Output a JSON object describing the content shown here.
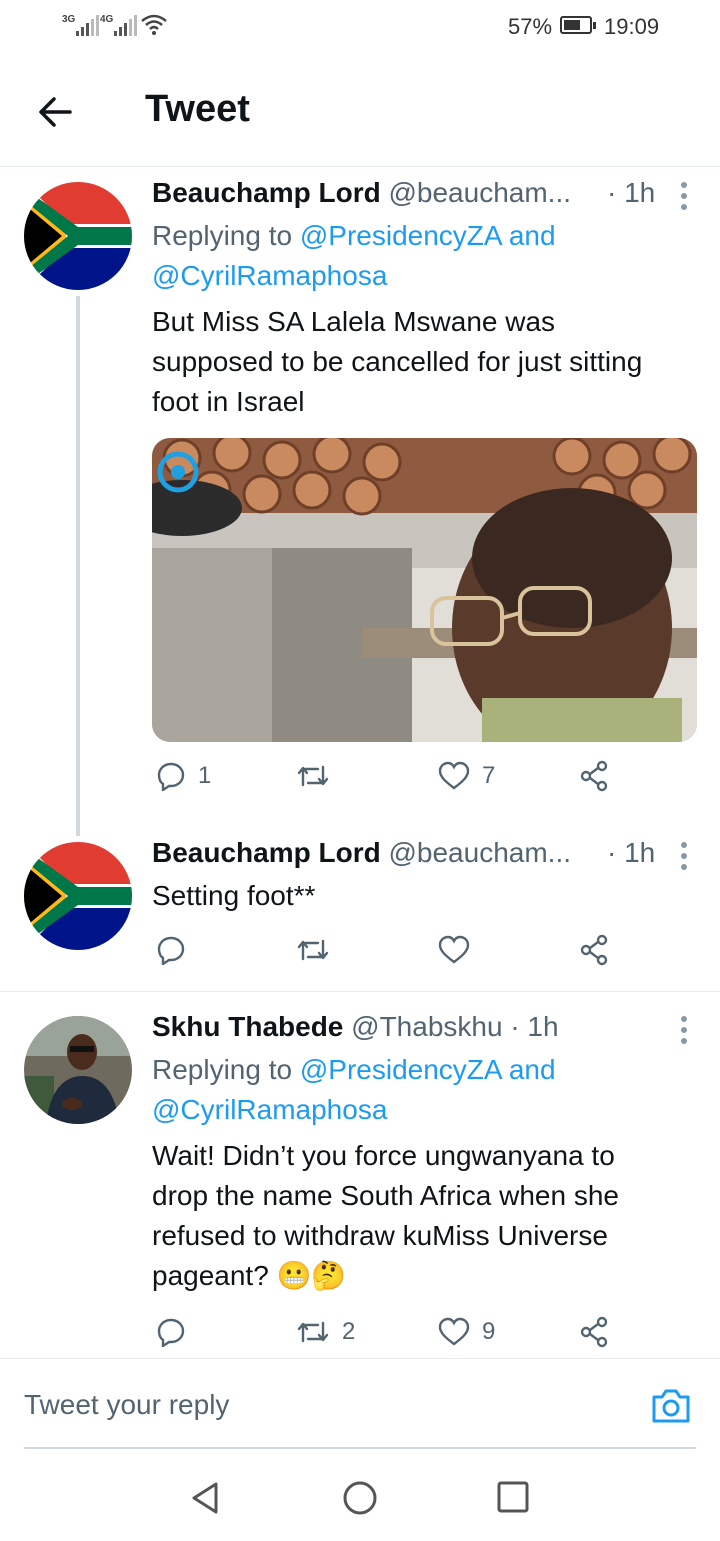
{
  "status": {
    "sim1": "3G",
    "sim2": "4G",
    "battery": "57%",
    "time": "19:09"
  },
  "header": {
    "title": "Tweet",
    "back_icon": "arrow-left-icon"
  },
  "tweets": [
    {
      "name": "Beauchamp Lord",
      "handle": "@beaucham...",
      "time": "· 1h",
      "replying_prefix": "Replying to",
      "replying_to": "@PresidencyZA and",
      "replying_to_2": "@CyrilRamaphosa",
      "text_lines": [
        "But Miss SA Lalela Mswane was",
        "supposed to be cancelled for just sitting",
        "foot in Israel"
      ],
      "has_media": true,
      "counts": {
        "reply": "1",
        "retweet": "",
        "like": "7"
      }
    },
    {
      "name": "Beauchamp Lord",
      "handle": "@beaucham...",
      "time": "· 1h",
      "text_lines": [
        "Setting foot**"
      ],
      "counts": {
        "reply": "",
        "retweet": "",
        "like": ""
      }
    },
    {
      "name": "Skhu Thabede",
      "handle": "@Thabskhu",
      "time": "· 1h",
      "replying_prefix": "Replying to",
      "replying_to": "@PresidencyZA and",
      "replying_to_2": "@CyrilRamaphosa",
      "text_lines": [
        "Wait! Didn’t you force ungwanyana to",
        "drop the name South Africa when she",
        "refused to withdraw kuMiss Universe",
        "pageant? 😬🤔"
      ],
      "counts": {
        "reply": "",
        "retweet": "2",
        "like": "9"
      }
    }
  ],
  "reply_bar": {
    "placeholder": "Tweet your reply",
    "icon": "camera-icon"
  },
  "colors": {
    "link": "#1d9bf0",
    "muted": "#536471",
    "divider": "#e6ecf0"
  }
}
